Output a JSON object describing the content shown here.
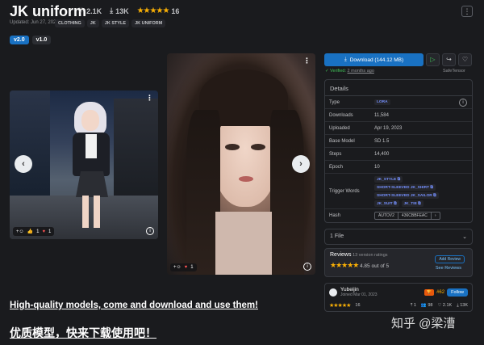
{
  "header": {
    "title": "JK uniform",
    "likes": "2.1K",
    "downloads": "13K",
    "rating_count": "16",
    "updated": "Updated: Jun 27, 2023",
    "tags": [
      "CLOTHING",
      "JK",
      "JK STYLE",
      "JK UNIFORM"
    ],
    "versions": [
      "v2.0",
      "v1.0"
    ]
  },
  "gallery": {
    "img1_likes": "1",
    "img1_hearts": "1",
    "img2_hearts": "1"
  },
  "download": {
    "label": "Download (144.12 MB)",
    "verified": "Verified:",
    "verified_time": "2 months ago",
    "format": "SafeTensor"
  },
  "details": {
    "title": "Details",
    "rows": [
      {
        "k": "Type",
        "v": "LORA"
      },
      {
        "k": "Downloads",
        "v": "11,584"
      },
      {
        "k": "Uploaded",
        "v": "Apr 19, 2023"
      },
      {
        "k": "Base Model",
        "v": "SD 1.5"
      },
      {
        "k": "Steps",
        "v": "14,400"
      },
      {
        "k": "Epoch",
        "v": "10"
      }
    ],
    "trigger_label": "Trigger Words",
    "trigger_words": [
      "JK_STYLE",
      "SHORT-SLEEVED JK_SHIRT",
      "SHORT-SLEEVED JK_SAILOR",
      "JK_SUIT",
      "JK_TIE"
    ],
    "hash_label": "Hash",
    "hash_type": "AUTOV2",
    "hash_value": "436CBBFEAC"
  },
  "files": {
    "label": "1 File"
  },
  "reviews": {
    "title": "Reviews",
    "version_ratings": "13 version ratings",
    "score": "4.85 out of 5",
    "add": "Add Review",
    "see": "See Reviews"
  },
  "creator": {
    "name": "Yubeijin",
    "joined": "Joined Mar 01, 2023",
    "rank": "#62",
    "follow": "Follow",
    "rating_count": "16",
    "uploads": "1",
    "followers": "98",
    "likes": "2.1K",
    "downloads": "13K"
  },
  "promo": {
    "en": "High-quality models, come and download and use them!",
    "cn": "优质模型，快来下载使用吧！"
  },
  "watermark": "知乎 @梁漕",
  "colors": {
    "accent": "#1971c2",
    "star": "#fab005",
    "verified": "#40c057"
  }
}
